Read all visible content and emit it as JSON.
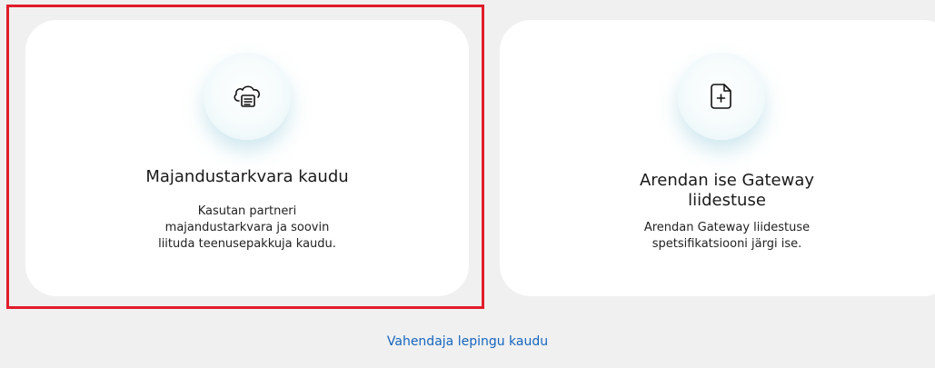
{
  "cards": [
    {
      "icon": "cloud-document-icon",
      "title": "Majandustarkvara kaudu",
      "description_lines": [
        "Kasutan partneri",
        "majandustarkvara ja soovin",
        "liituda teenusepakkuja kaudu."
      ]
    },
    {
      "icon": "file-plus-icon",
      "title_lines": [
        "Arendan ise Gateway",
        "liidestuse"
      ],
      "description_lines": [
        "Arendan Gateway liidestuse",
        "spetsifikatsiooni järgi ise."
      ]
    }
  ],
  "footer": {
    "link_label": "Vahendaja lepingu kaudu"
  },
  "colors": {
    "background": "#f0f0f0",
    "card": "#ffffff",
    "highlight_border": "#e11d2a",
    "link": "#1565c0"
  }
}
